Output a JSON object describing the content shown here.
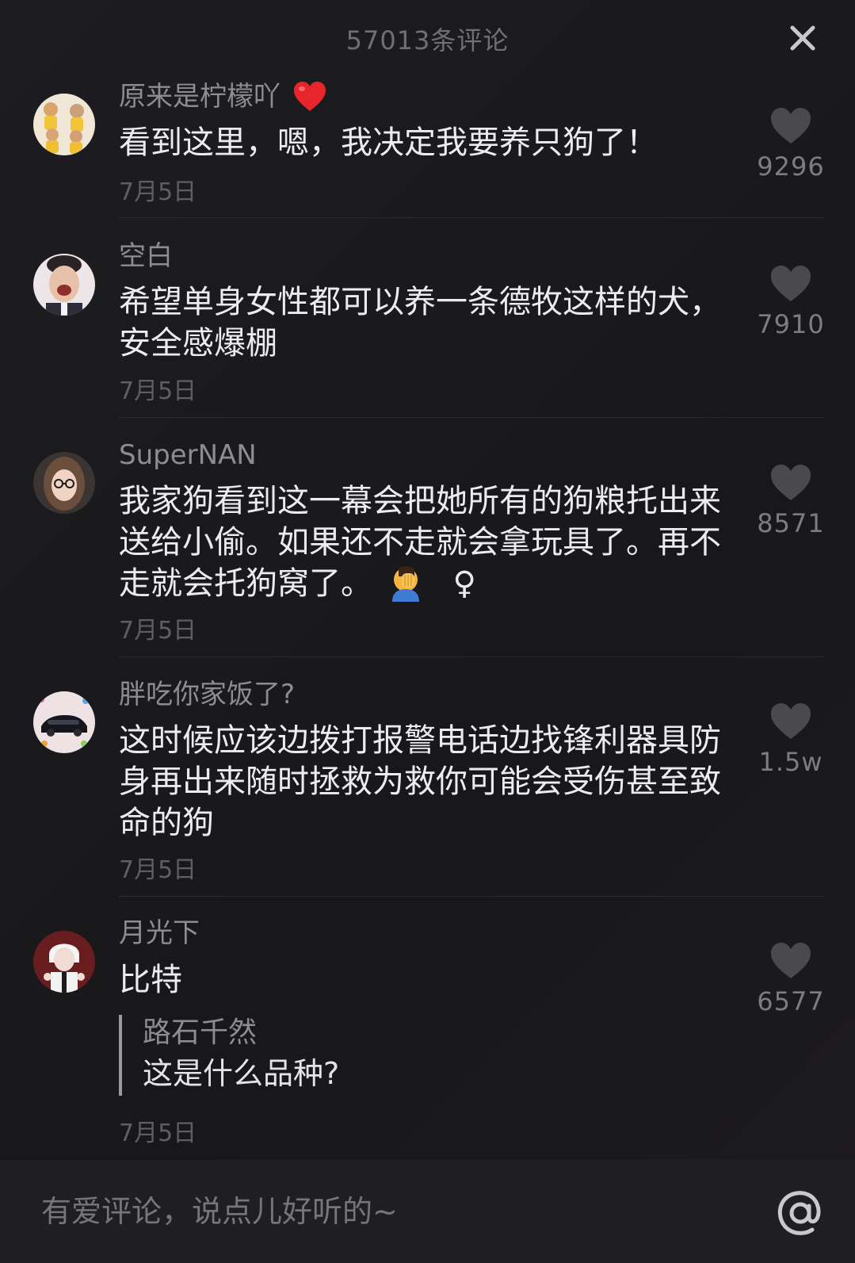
{
  "header": {
    "title": "57013条评论"
  },
  "comments": [
    {
      "username": "原来是柠檬吖",
      "text": "看到这里，嗯，我决定我要养只狗了！",
      "date": "7月5日",
      "likes": "9296",
      "avatar": "kids-avatar"
    },
    {
      "username": "空白",
      "text": "希望单身女性都可以养一条德牧这样的犬，安全感爆棚",
      "date": "7月5日",
      "likes": "7910",
      "avatar": "laughing-man-avatar"
    },
    {
      "username": "SuperNAN",
      "text": "我家狗看到这一幕会把她所有的狗粮托出来 送给小偷。如果还不走就会拿玩具了。再不走就会托狗窝了。",
      "text_suffix": "♀",
      "date": "7月5日",
      "likes": "8571",
      "avatar": "woman-glasses-avatar"
    },
    {
      "username": "胖吃你家饭了?",
      "text": "这时候应该边拨打报警电话边找锋利器具防身再出来随时拯救为救你可能会受伤甚至致命的狗",
      "date": "7月5日",
      "likes": "1.5w",
      "avatar": "car-avatar"
    },
    {
      "username": "月光下",
      "text": "比特",
      "reply": {
        "username": "路石千然",
        "text": "这是什么品种?"
      },
      "date": "7月5日",
      "likes": "6577",
      "avatar": "anime-avatar"
    }
  ],
  "input": {
    "placeholder": "有爱评论，说点儿好听的~"
  },
  "colors": {
    "background": "#1a1a1c",
    "heart": "#4a4a4f",
    "heart_red": "#e8252b"
  },
  "icons": {
    "close": "close-icon",
    "like": "heart-icon",
    "mention": "at-icon",
    "emoji_heart": "red-heart-emoji",
    "emoji_facepalm": "facepalm-emoji"
  }
}
